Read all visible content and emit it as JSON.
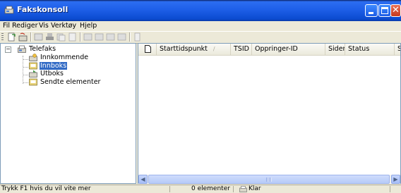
{
  "window": {
    "title": "Fakskonsoll"
  },
  "menu": {
    "items": [
      "Fil",
      "Rediger",
      "Vis",
      "Verktøy",
      "Hjelp"
    ]
  },
  "toolbar": {
    "icons": [
      "new-fax-icon",
      "receive-fax-icon",
      "fax-properties-icon",
      "print-icon",
      "copy-icon",
      "page-icon",
      "pause-icon",
      "resume-icon",
      "restart-icon",
      "delete-icon",
      "document-icon"
    ]
  },
  "tree": {
    "root": "Telefaks",
    "children": [
      "Innkommende",
      "Innboks",
      "Utboks",
      "Sendte elementer"
    ],
    "selected": "Innboks"
  },
  "list": {
    "columns": [
      "Starttidspunkt",
      "TSID",
      "Oppringer-ID",
      "Sider",
      "Status",
      "St"
    ],
    "sort_arrow": "/",
    "rows": []
  },
  "status": {
    "help": "Trykk F1 hvis du vil vite mer",
    "count": "0 elementer",
    "state": "Klar"
  },
  "colors": {
    "titlebar": "#0b4bd0",
    "selection": "#316ac5",
    "chrome": "#ece9d8"
  }
}
